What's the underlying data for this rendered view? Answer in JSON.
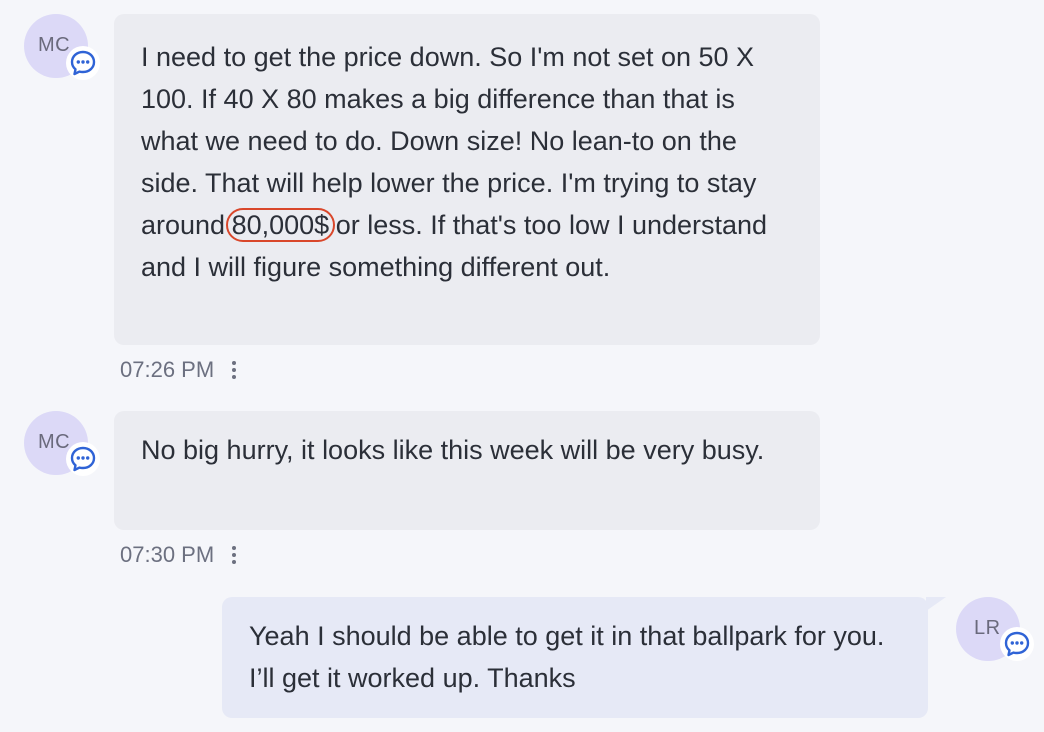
{
  "messages": [
    {
      "avatar": "MC",
      "text_before": "I need to get the price down. So I'm not set on 50 X 100. If 40 X 80 makes a big difference than that is what we need to do. Down size! No lean-to on the side. That will help lower the price. I'm trying to stay around ",
      "highlight": "80,000$",
      "text_after": " or less. If that's too low I understand and I will figure something different out.",
      "time": "07:26 PM"
    },
    {
      "avatar": "MC",
      "text": "No big hurry, it looks like this week will be very busy.",
      "time": "07:30 PM"
    },
    {
      "avatar": "LR",
      "text": "Yeah I should be able to get it in that ballpark for you. I’ll get it worked up. Thanks"
    }
  ],
  "icons": {
    "channel": "chat-bubble-icon",
    "menu": "more-vertical-icon"
  },
  "colors": {
    "accent": "#2f63d6",
    "highlight_circle": "#d9472b",
    "avatar_bg": "#dcd9f7",
    "incoming_bubble": "#ebecf1",
    "outgoing_bubble": "#e6e9f6"
  }
}
